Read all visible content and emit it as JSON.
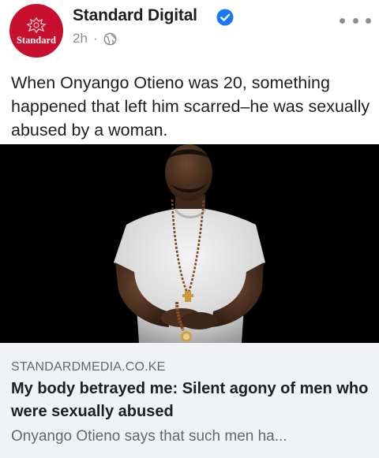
{
  "post": {
    "page_name": "Standard Digital",
    "avatar_text": "Standard",
    "timestamp": "2h",
    "separator": "·",
    "audience_icon": "globe-icon",
    "verified_icon": "verified-badge-icon",
    "more_icon": "more-options-icon",
    "text": "When Onyango Otieno was 20, something happened that left him scarred–he was sexually abused by a woman."
  },
  "link_preview": {
    "domain": "STANDARDMEDIA.CO.KE",
    "headline": "My body betrayed me: Silent agony of men who were sexually abused",
    "description": "Onyango Otieno says that such men ha..."
  },
  "colors": {
    "brand_red": "#c8102e",
    "verified_blue": "#1877f2",
    "secondary_text": "#65676b",
    "card_background": "#f0f2f5"
  }
}
